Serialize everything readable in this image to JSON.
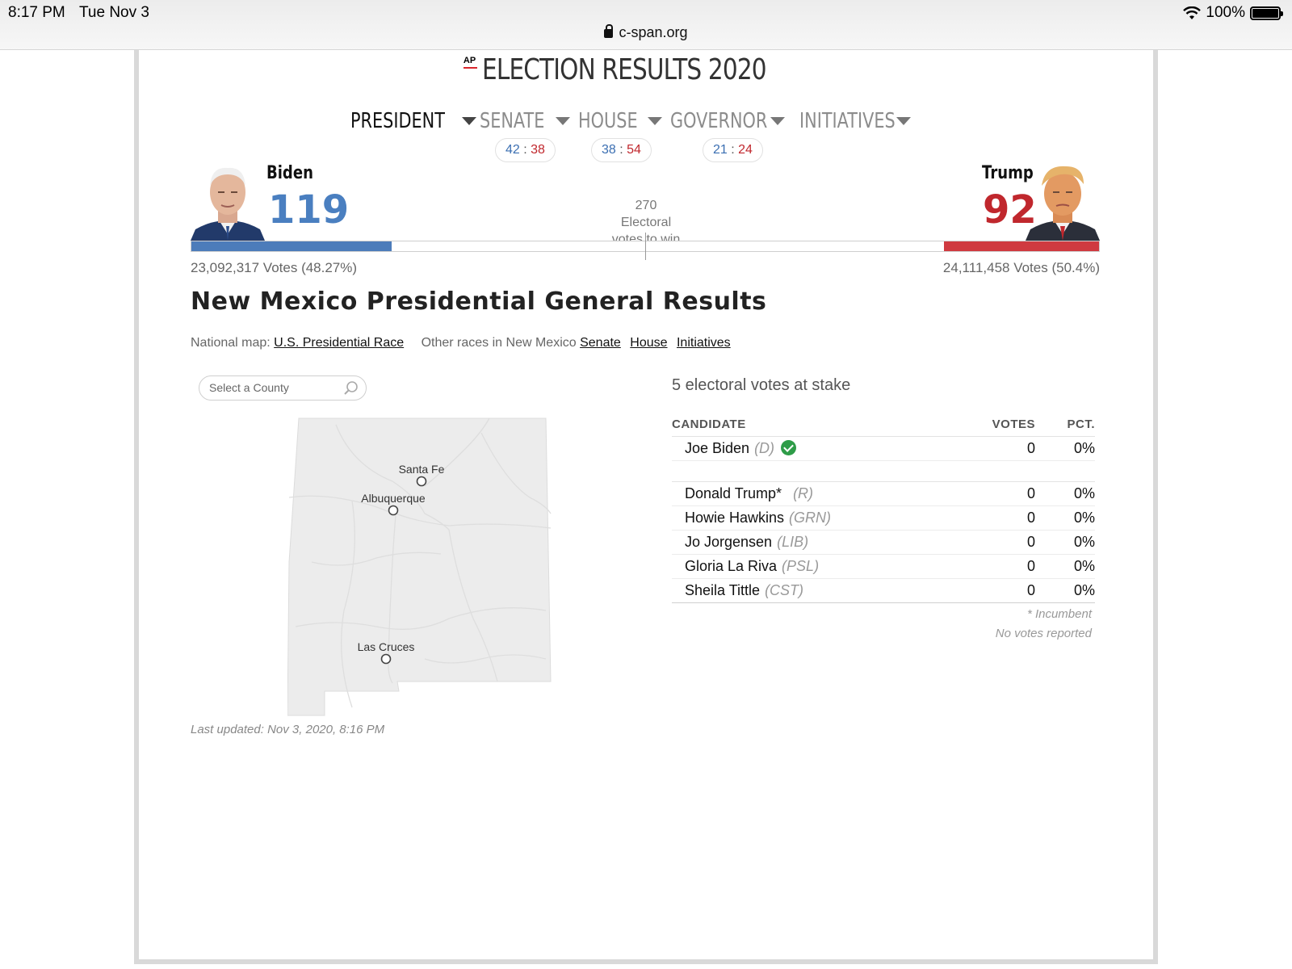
{
  "status_bar": {
    "time": "8:17 PM",
    "date": "Tue Nov 3",
    "battery": "100%"
  },
  "browser": {
    "url": "c-span.org"
  },
  "header": {
    "logo": "AP",
    "title": "ELECTION RESULTS 2020"
  },
  "race_tabs": [
    {
      "label": "PRESIDENT",
      "active": true
    },
    {
      "label": "SENATE",
      "dem": "42",
      "rep": "38"
    },
    {
      "label": "HOUSE",
      "dem": "38",
      "rep": "54"
    },
    {
      "label": "GOVERNOR",
      "dem": "21",
      "rep": "24"
    },
    {
      "label": "INITIATIVES"
    }
  ],
  "score_separator": ":",
  "candidates": {
    "dem": {
      "name": "Biden",
      "electoral_votes": "119",
      "popular_vote": "23,092,317 Votes (48.27%)",
      "bar_fraction": 0.2204,
      "color": "#4c7cba"
    },
    "rep": {
      "name": "Trump",
      "electoral_votes": "92",
      "popular_vote": "24,111,458 Votes (50.4%)",
      "bar_fraction": 0.1704,
      "color": "#cf3a40"
    }
  },
  "threshold": {
    "line1": "270",
    "line2": "Electoral",
    "line3": "votes to win"
  },
  "state": {
    "title": "New Mexico Presidential General Results",
    "national_label": "National map:",
    "national_link": "U.S. Presidential Race",
    "other_label": "Other races in New Mexico",
    "other_links": [
      "Senate",
      "House",
      "Initiatives"
    ]
  },
  "county_search": {
    "placeholder": "Select a County"
  },
  "map": {
    "cities": [
      "Santa Fe",
      "Albuquerque",
      "Las Cruces"
    ]
  },
  "last_updated": "Last updated: Nov 3, 2020, 8:16 PM",
  "results": {
    "stake": "5 electoral votes at stake",
    "headers": {
      "candidate": "CANDIDATE",
      "votes": "VOTES",
      "pct": "PCT."
    },
    "winner": {
      "name": "Joe Biden",
      "party": "(D)",
      "votes": "0",
      "pct": "0%"
    },
    "rows": [
      {
        "name": "Donald Trump*",
        "party": "(R)",
        "votes": "0",
        "pct": "0%"
      },
      {
        "name": "Howie Hawkins",
        "party": "(GRN)",
        "votes": "0",
        "pct": "0%"
      },
      {
        "name": "Jo Jorgensen",
        "party": "(LIB)",
        "votes": "0",
        "pct": "0%"
      },
      {
        "name": "Gloria La Riva",
        "party": "(PSL)",
        "votes": "0",
        "pct": "0%"
      },
      {
        "name": "Sheila Tittle",
        "party": "(CST)",
        "votes": "0",
        "pct": "0%"
      }
    ],
    "incumbent_note": "* Incumbent",
    "no_votes_note": "No votes reported"
  }
}
